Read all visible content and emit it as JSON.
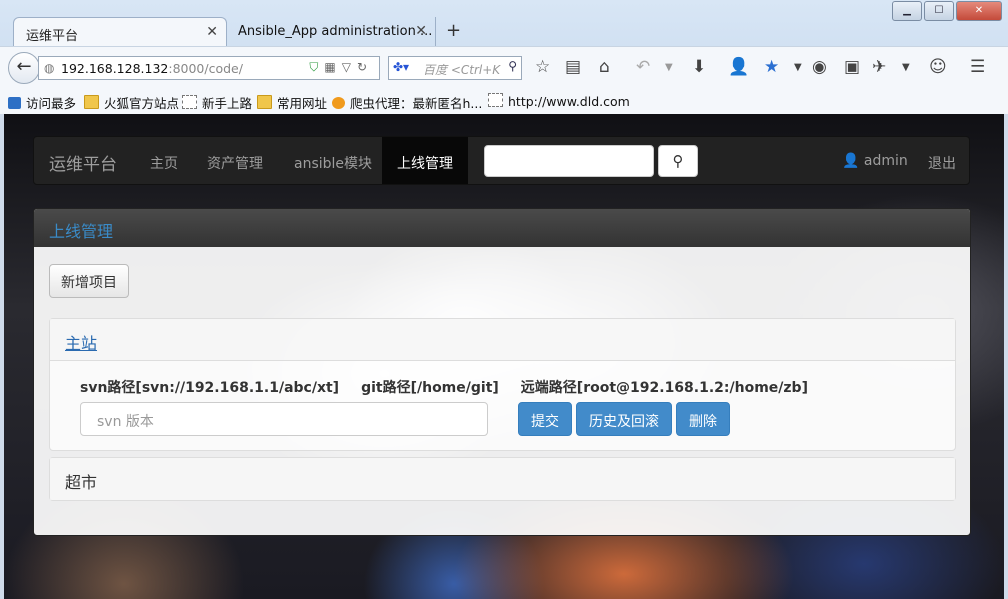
{
  "browser": {
    "tabs": [
      {
        "label": "运维平台",
        "active": true
      },
      {
        "label": "Ansible_App administration ...",
        "active": false
      }
    ],
    "url": {
      "host": "192.168.128.132",
      "rest": ":8000/code/"
    },
    "search": {
      "placeholder": "百度 <Ctrl+K"
    },
    "bookmarks": [
      {
        "label": "访问最多",
        "icon": "firefox-icon"
      },
      {
        "label": "火狐官方站点",
        "icon": "folder-icon"
      },
      {
        "label": "新手上路",
        "icon": "page-icon"
      },
      {
        "label": "常用网址",
        "icon": "folder-icon"
      },
      {
        "label": "爬虫代理：最新匿名h...",
        "icon": "bug-icon"
      },
      {
        "label": "http://www.dld.com",
        "icon": "page-icon"
      }
    ]
  },
  "app": {
    "brand": "运维平台",
    "nav": [
      {
        "label": "主页"
      },
      {
        "label": "资产管理"
      },
      {
        "label": "ansible模块"
      },
      {
        "label": "上线管理",
        "active": true
      }
    ],
    "user": "admin",
    "logout": "退出",
    "panel_title": "上线管理",
    "add_button": "新增项目",
    "projects": [
      {
        "name": "主站",
        "svn_path": "svn路径[svn://192.168.1.1/abc/xt]",
        "git_path": "git路径[/home/git]",
        "remote_path": "远端路径[root@192.168.1.2:/home/zb]",
        "version_placeholder": "svn 版本",
        "buttons": {
          "submit": "提交",
          "history": "历史及回滚",
          "delete": "删除"
        }
      },
      {
        "name": "超市"
      }
    ]
  },
  "colors": {
    "accent": "#428bca",
    "navbar": "#222222",
    "heading": "#3a8bc8"
  }
}
